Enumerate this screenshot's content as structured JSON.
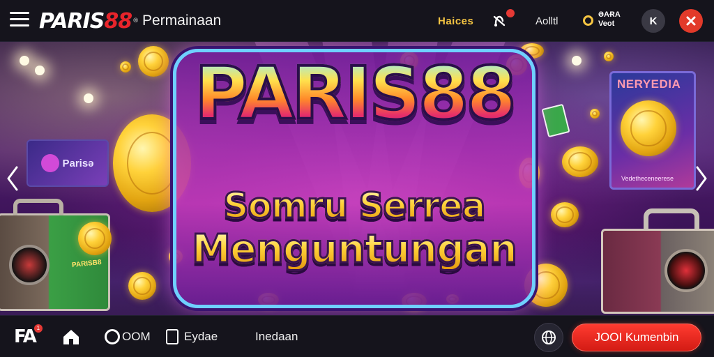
{
  "header": {
    "logo_left": "PARIS",
    "logo_right": "88",
    "logo_reg": "®",
    "nav_title": "Permainaan",
    "link_1": "Haices",
    "link_2": "Aolltl",
    "badge_line_1": "ƏAɌA",
    "badge_line_2": "Veot",
    "circle_k": "K",
    "icons": [
      "menu-icon",
      "bell-icon",
      "coin-icon",
      "user-icon",
      "gift-icon"
    ],
    "colors": {
      "accent_gold": "#f5c542",
      "accent_red": "#e23a2a"
    }
  },
  "banner": {
    "title": "PARIS88",
    "subtitle_1": "Somru Serrea",
    "subtitle_2": "Menguntungan",
    "left_screen_label": "Parisə",
    "right_screen_title": "NERYEDIA",
    "right_screen_sub": "Vedetheceneerese",
    "box_label": "PARISB8",
    "nav_prev_icon": "chevron-left-icon",
    "nav_next_icon": "chevron-right-icon"
  },
  "bottom_nav": {
    "fa_label": "FA",
    "fa_badge": "1",
    "com_label": "OOM",
    "event_label": "Eydae",
    "inbox_label": "Inedaan",
    "cta_label": "JOOI Kumenbin",
    "icons": [
      "home-icon",
      "globe-icon"
    ]
  }
}
